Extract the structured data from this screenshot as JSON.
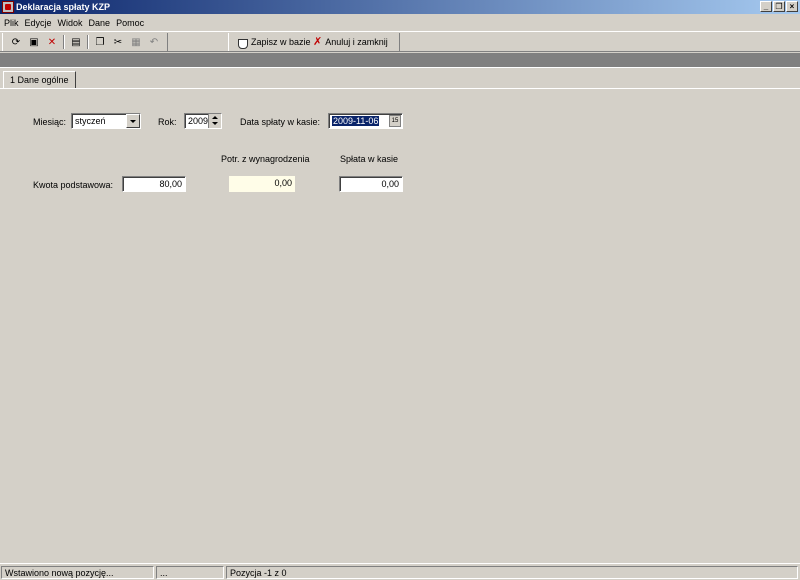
{
  "window": {
    "title": "Deklaracja spłaty KZP",
    "minimize": "_",
    "restore": "❐",
    "close": "×"
  },
  "menu": [
    "Plik",
    "Edycje",
    "Widok",
    "Dane",
    "Pomoc"
  ],
  "toolbar": {
    "icons": [
      "refresh-icon",
      "save-icon",
      "delete-icon",
      "properties-icon",
      "copy-icon",
      "cut-icon",
      "paste-icon",
      "undo-icon"
    ],
    "save_label": "Zapisz w bazie",
    "cancel_label": "Anuluj i zamknij"
  },
  "tabs": [
    {
      "label": "1 Dane ogólne"
    }
  ],
  "form": {
    "month_label": "Miesiąc:",
    "month_value": "styczeń",
    "year_label": "Rok:",
    "year_value": "2009",
    "date_label": "Data spłaty w kasie:",
    "date_value": "2009-11-06",
    "date_btn": "15",
    "col_withheld": "Potr. z wynagrodzenia",
    "col_paid": "Spłata w kasie",
    "base_label": "Kwota podstawowa:",
    "base_value": "80,00",
    "withheld_value": "0,00",
    "paid_value": "0,00"
  },
  "status": {
    "message": "Wstawiono nową pozycję...",
    "middle": "...",
    "position": "Pozycja -1 z 0"
  },
  "colors": {
    "titlebar_start": "#0a246a",
    "titlebar_end": "#a6caf0",
    "face": "#d4d0c8",
    "readonly_bg": "#fffde8"
  }
}
